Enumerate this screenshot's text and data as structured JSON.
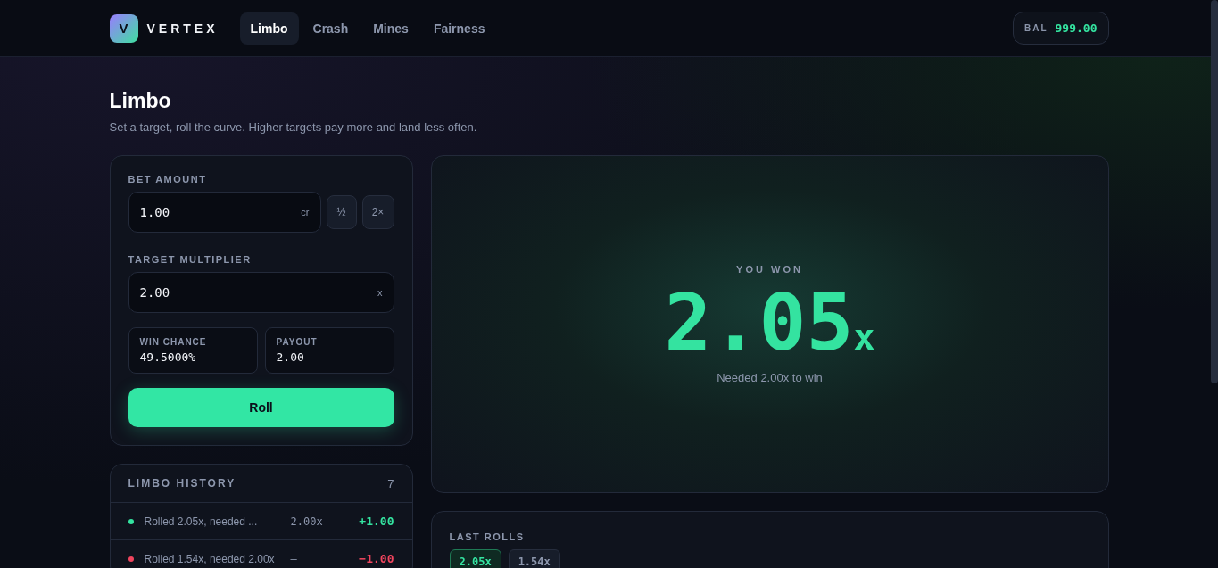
{
  "brand": {
    "logo": "V",
    "name": "VERTEX"
  },
  "nav": [
    {
      "label": "Limbo",
      "selected": true
    },
    {
      "label": "Crash",
      "selected": false
    },
    {
      "label": "Mines",
      "selected": false
    },
    {
      "label": "Fairness",
      "selected": false
    }
  ],
  "balance": {
    "label": "BAL",
    "value": "999.00"
  },
  "page": {
    "title": "Limbo",
    "subtitle": "Set a target, roll the curve. Higher targets pay more and land less often."
  },
  "bet": {
    "label": "BET AMOUNT",
    "value": "1.00",
    "unit": "cr",
    "buttons": [
      "½",
      "2×"
    ]
  },
  "target": {
    "label": "TARGET MULTIPLIER",
    "value": "2.00",
    "unit": "x"
  },
  "stats": [
    {
      "label": "WIN CHANCE",
      "value": "49.5000%"
    },
    {
      "label": "PAYOUT",
      "value": "2.00"
    }
  ],
  "roll_button": "Roll",
  "history": {
    "title": "LIMBO HISTORY",
    "count": "7",
    "rows": [
      {
        "color": "#34e3a0",
        "text": "Rolled 2.05x, needed ...",
        "multiplier": "2.00x",
        "amount": "+1.00"
      },
      {
        "color": "#f0455e",
        "text": "Rolled 1.54x, needed 2.00x",
        "multiplier": "—",
        "amount": "−1.00"
      }
    ]
  },
  "result": {
    "won": true,
    "heading": "YOU WON",
    "value": "2.05",
    "suffix": "x",
    "note": "Needed 2.00x to win"
  },
  "last_rolls": {
    "title": "LAST ROLLS",
    "items": [
      {
        "highlighted": true,
        "value": "2.05x"
      },
      {
        "highlighted": false,
        "value": "1.54x"
      }
    ]
  }
}
